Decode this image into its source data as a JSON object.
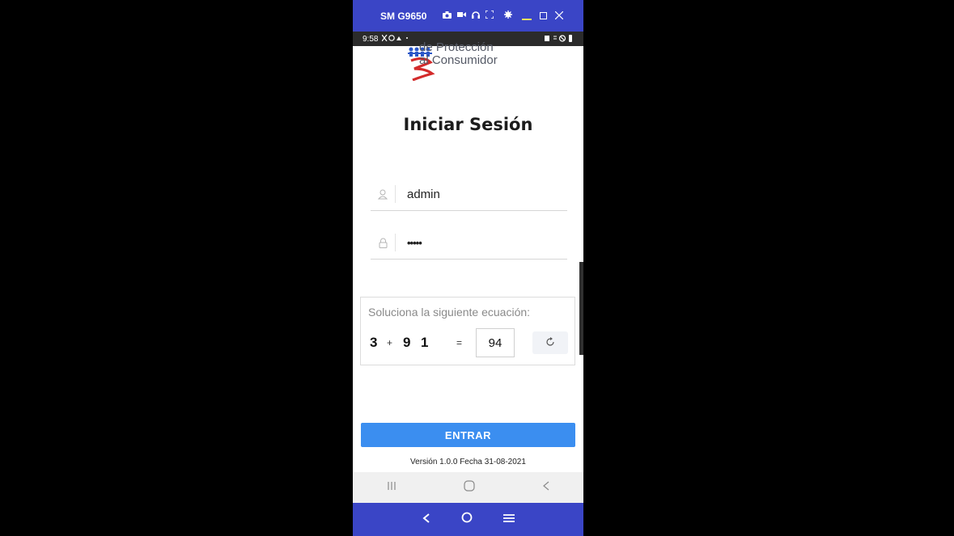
{
  "emulator": {
    "title": "SM G9650",
    "toolbar_icons": [
      "camera-icon",
      "video-icon",
      "headphones-icon",
      "fullscreen-icon",
      "settings-icon"
    ],
    "window_buttons": [
      "minimize-icon",
      "maximize-icon",
      "close-icon"
    ],
    "nav_icons": [
      "back-icon",
      "home-icon",
      "menu-icon"
    ],
    "accent": "#3a45c6"
  },
  "status_bar": {
    "time": "9:58"
  },
  "logo": {
    "line1": "de Protección",
    "line2": "al Consumidor"
  },
  "login": {
    "title": "Iniciar Sesión",
    "username_value": "admin",
    "password_value": "•••••",
    "username_icon": "user-icon",
    "password_icon": "lock-icon"
  },
  "captcha": {
    "prompt": "Soluciona la siguiente ecuación:",
    "operand1": "3",
    "plus": "+",
    "operand2_a": "9",
    "operand2_b": "1",
    "equals": "=",
    "answer": "94",
    "refresh_icon": "refresh-icon"
  },
  "submit": {
    "label": "ENTRAR",
    "color": "#3b8ef0"
  },
  "version": "Versión 1.0.0 Fecha 31-08-2021"
}
